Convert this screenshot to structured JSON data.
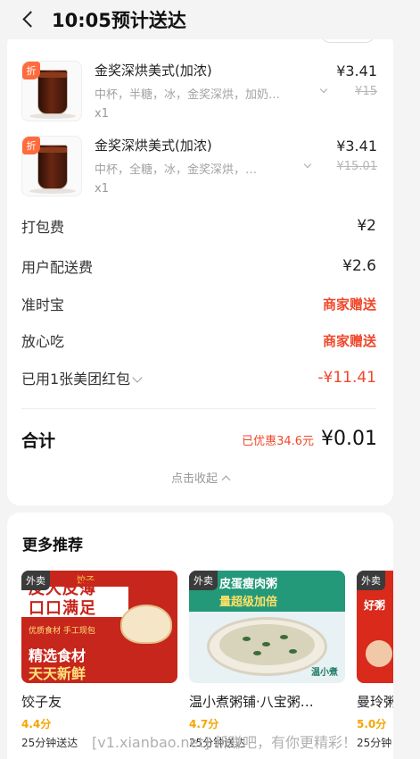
{
  "header": {
    "title": "10:05预计送达"
  },
  "order_items": [
    {
      "name": "金奖深烘美式(加浓)",
      "spec": "中杯，半糖，冰，金奖深烘，加奶…",
      "qty": "x1",
      "price": "¥3.41",
      "original_price": "¥15",
      "discount_badge": "折"
    },
    {
      "name": "金奖深烘美式(加浓)",
      "spec": "中杯，全糖，冰，金奖深烘，…",
      "qty": "x1",
      "price": "¥3.41",
      "original_price": "¥15.01",
      "discount_badge": "折"
    }
  ],
  "fees": {
    "packaging": {
      "label": "打包费",
      "value": "¥2"
    },
    "delivery": {
      "label": "用户配送费",
      "value": "¥2.6"
    },
    "ontime": {
      "label": "准时宝",
      "value": "商家赠送"
    },
    "safe_eat": {
      "label": "放心吃",
      "value": "商家赠送"
    },
    "redpacket": {
      "label": "已用1张美团红包",
      "value": "-¥11.41"
    }
  },
  "total": {
    "label": "合计",
    "saved": "已优惠34.6元",
    "amount": "¥0.01"
  },
  "collapse_label": "点击收起",
  "recommend": {
    "title": "更多推荐",
    "items": [
      {
        "tag": "外卖",
        "name": "饺子友",
        "score": "4.4分",
        "eta": "25分钟送达",
        "poster": {
          "line1": "皮大皮薄",
          "line2": "口口满足",
          "sub": "优质食材 手工现包",
          "line3": "精选食材",
          "line4": "天天新鲜",
          "logo": "饺子"
        }
      },
      {
        "tag": "外卖",
        "name": "温小煮粥铺·八宝粥…",
        "score": "4.7分",
        "eta": "25分钟送达",
        "poster": {
          "line1": "皮蛋瘦肉粥",
          "line2": "量超级加倍",
          "brand": "温小煮"
        }
      },
      {
        "tag": "外卖",
        "name": "曼玲粥",
        "score": "5.0分",
        "eta": "25分钟",
        "poster": {
          "line1": "好粥"
        }
      }
    ]
  },
  "watermark": "[v1.xianbao.net] 新赚吧，有你更精彩！",
  "colors": {
    "accent_red": "#f0472b",
    "score_yellow": "#f6a400",
    "discount_orange": "#ff6b3d"
  }
}
